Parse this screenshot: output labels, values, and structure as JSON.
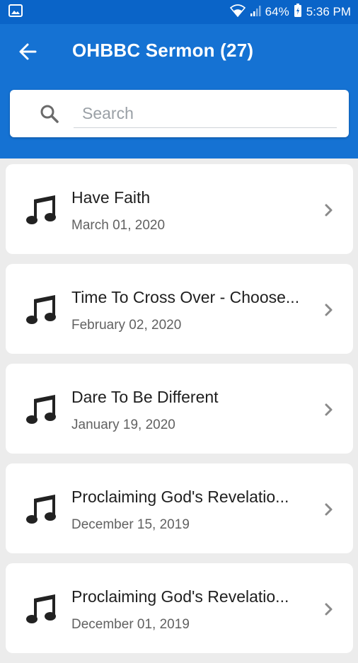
{
  "status_bar": {
    "battery": "64%",
    "time": "5:36 PM",
    "icons": [
      "image-icon",
      "wifi-icon",
      "signal-icon",
      "battery-icon"
    ]
  },
  "app_bar": {
    "title": "OHBBC Sermon (27)",
    "back_icon": "arrow-left-icon"
  },
  "search": {
    "placeholder": "Search",
    "value": ""
  },
  "sermons": [
    {
      "title": "Have Faith",
      "date": "March 01, 2020"
    },
    {
      "title": "Time To Cross Over - Choose...",
      "date": "February 02, 2020"
    },
    {
      "title": "Dare To Be Different",
      "date": "January 19, 2020"
    },
    {
      "title": "Proclaiming God's Revelatio...",
      "date": "December 15, 2019"
    },
    {
      "title": "Proclaiming God's Revelatio...",
      "date": "December 01, 2019"
    }
  ],
  "colors": {
    "status_bar": "#0a64c8",
    "app_bar": "#1572d3",
    "background": "#ececec",
    "card": "#ffffff"
  }
}
